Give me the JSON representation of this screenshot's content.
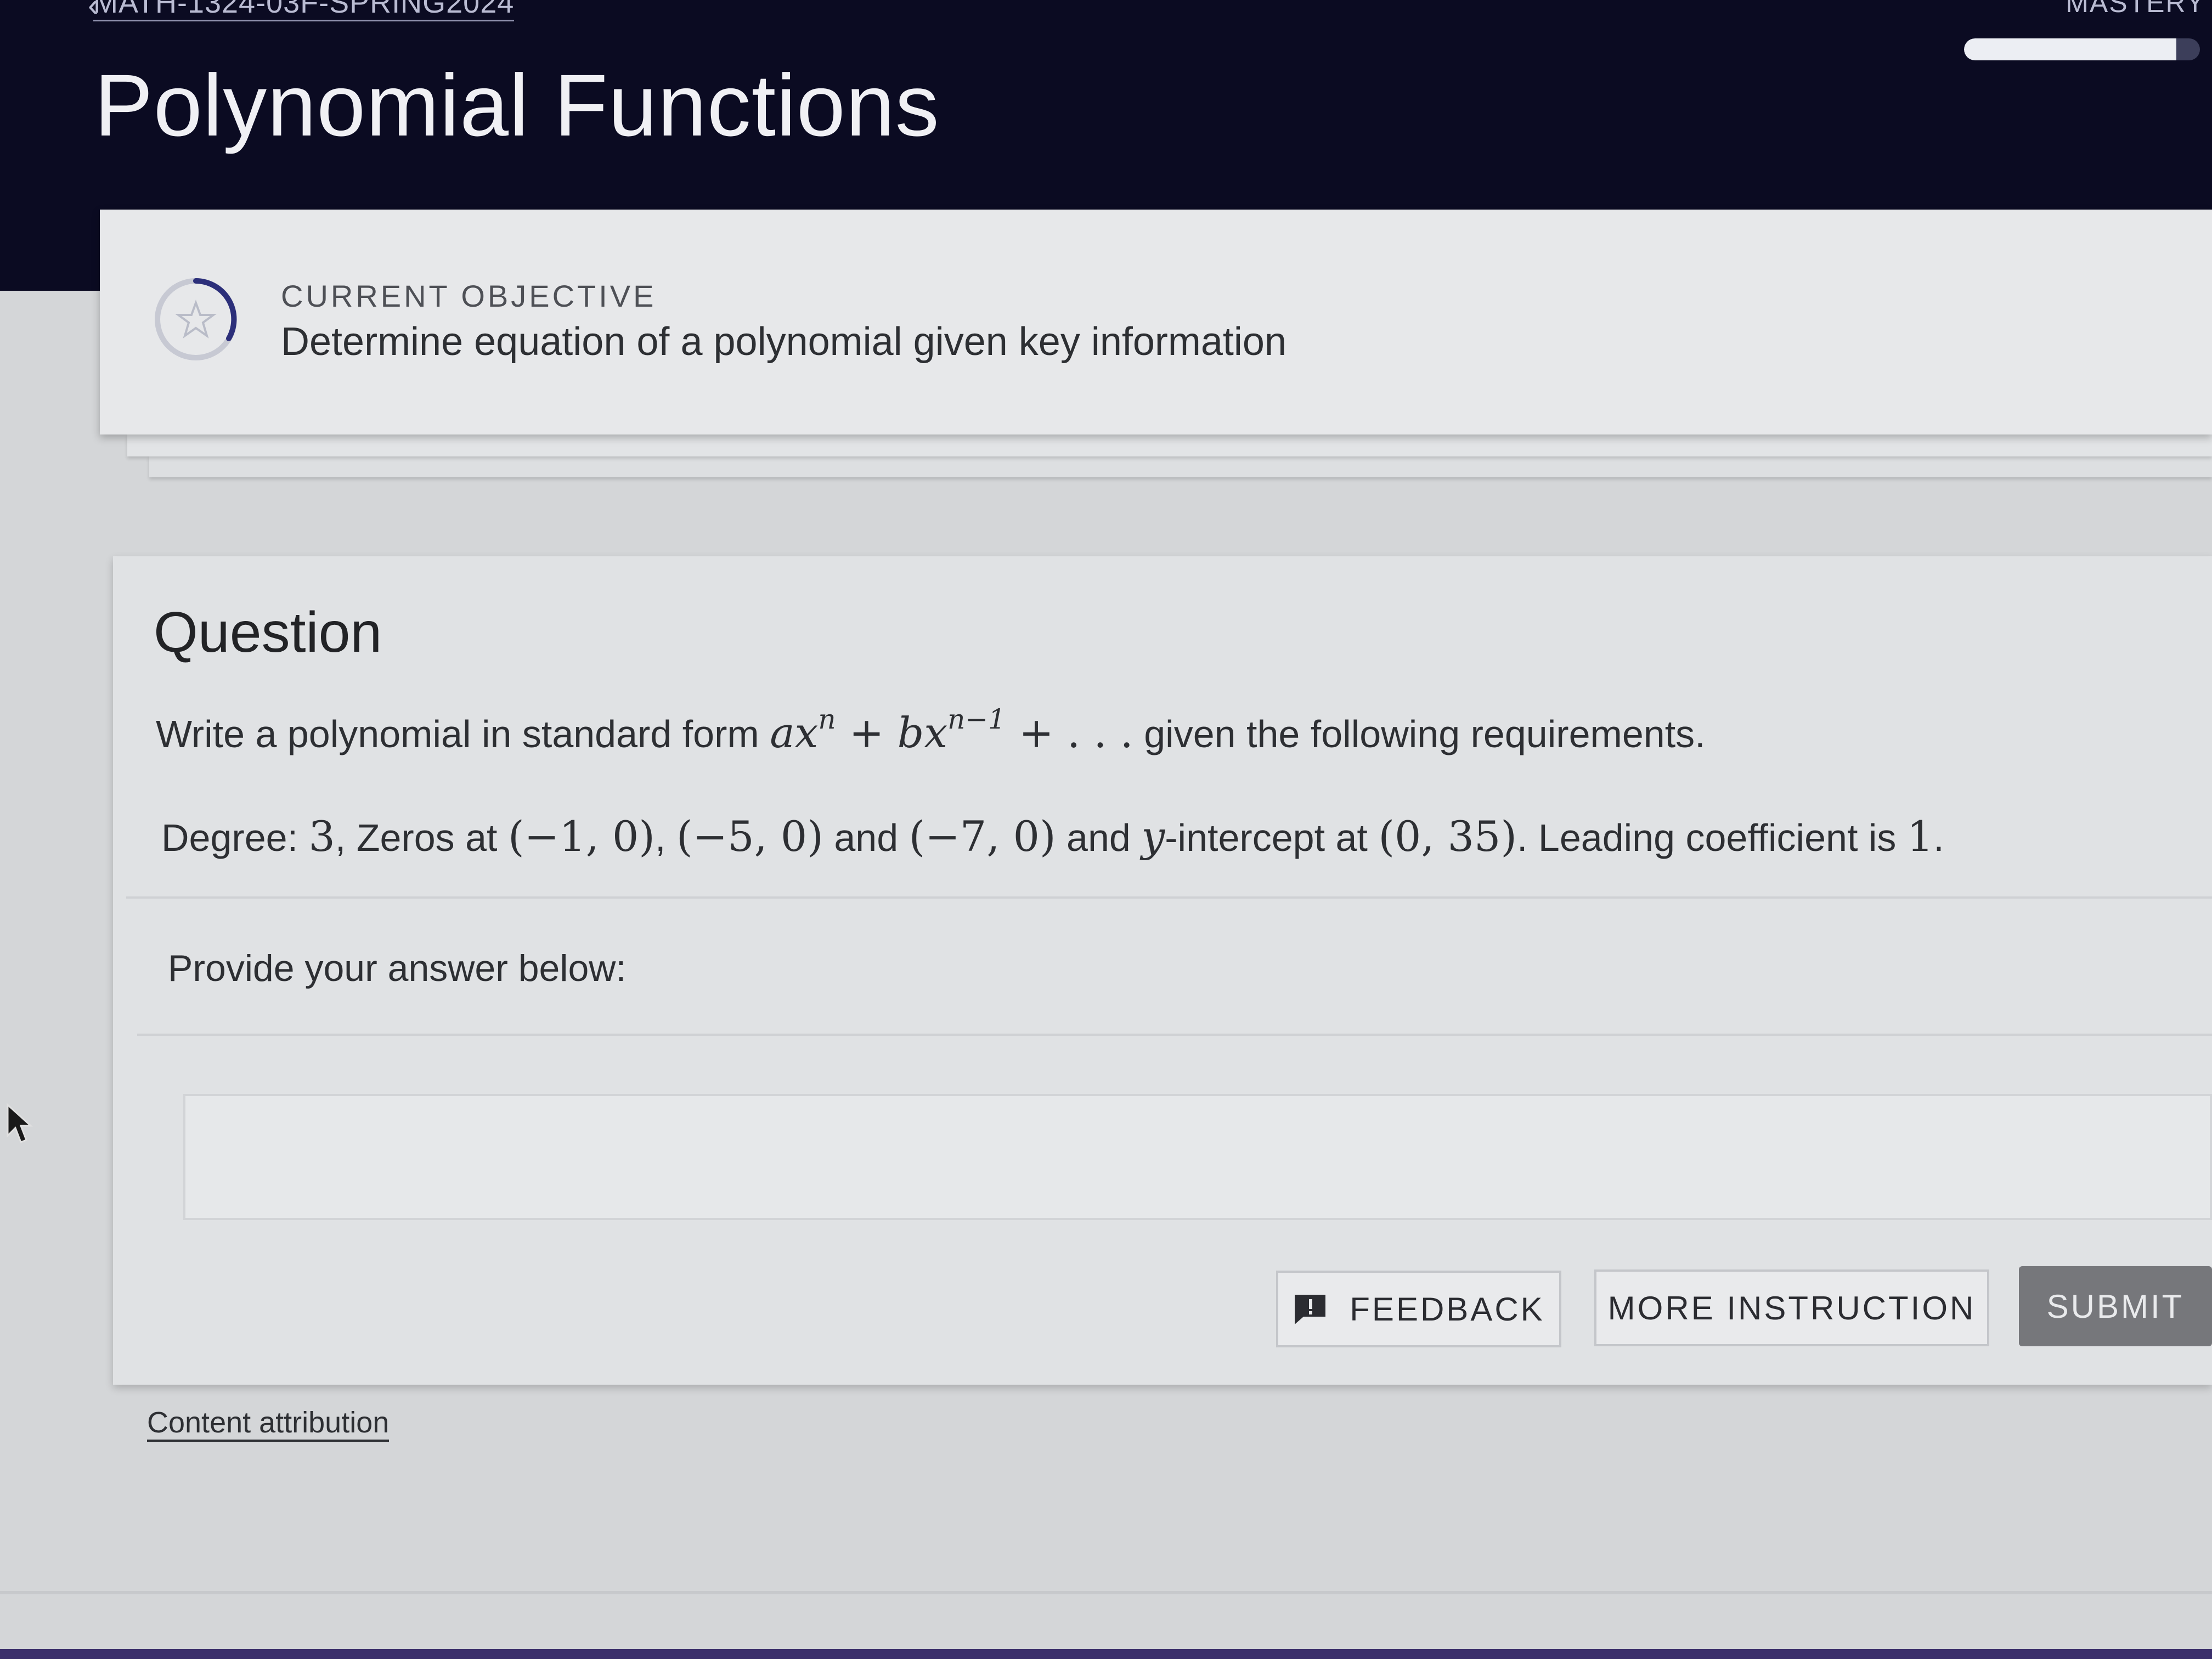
{
  "header": {
    "course": "MATH-1324-03F-SPRING2024",
    "mastery_label": "MASTERY",
    "mastery_progress": 0.9,
    "title": "Polynomial Functions"
  },
  "objective": {
    "label": "CURRENT OBJECTIVE",
    "text": "Determine equation of a polynomial given key information"
  },
  "question": {
    "heading": "Question",
    "line1_pre": "Write a polynomial in standard form ",
    "line1_math_a": "ax",
    "line1_math_n": "n",
    "line1_math_plus": " + ",
    "line1_math_b": "bx",
    "line1_math_n1": "n−1",
    "line1_math_tail": " + . . .",
    "line1_post": " given the following requirements.",
    "l2_degree_label": "Degree: ",
    "l2_degree_value": "3",
    "l2_zeros_label": ", Zeros at ",
    "l2_zero1": "(−1, 0)",
    "l2_comma": ", ",
    "l2_zero2": "(−5, 0)",
    "l2_and1": " and ",
    "l2_zero3": "(−7, 0)",
    "l2_and2": " and ",
    "l2_y": "y",
    "l2_intercept_label": "-intercept at ",
    "l2_intercept": "(0, 35)",
    "l2_leading": ". Leading coefficient is ",
    "l2_leading_value": "1",
    "l2_end": "."
  },
  "answer": {
    "prompt": "Provide your answer below:",
    "value": ""
  },
  "buttons": {
    "feedback": "FEEDBACK",
    "more_instruction": "MORE INSTRUCTION",
    "submit": "SUBMIT"
  },
  "footer": {
    "attribution": "Content attribution"
  },
  "icons": {
    "objective": "star-progress-icon",
    "feedback": "feedback-icon"
  },
  "colors": {
    "header_bg": "#0b0b22",
    "submit_bg": "#76777b",
    "accent": "#2c2f7a"
  }
}
